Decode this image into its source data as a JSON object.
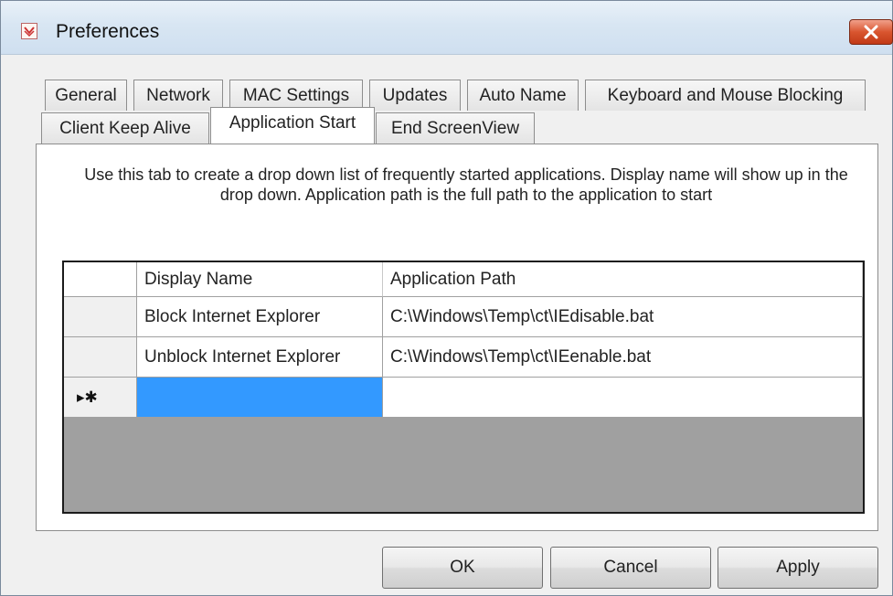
{
  "window": {
    "title": "Preferences"
  },
  "tabs": {
    "row1": [
      "General",
      "Network",
      "MAC Settings",
      "Updates",
      "Auto Name",
      "Keyboard and Mouse Blocking"
    ],
    "row2": [
      "Client Keep Alive",
      "Application Start",
      "End ScreenView"
    ],
    "active": "Application Start"
  },
  "panel": {
    "description": "Use this tab to create a drop down list of frequently started applications. Display name will show up in the drop down. Application path is the full path to the application to start"
  },
  "grid": {
    "columns": [
      "Display Name",
      "Application Path"
    ],
    "rows": [
      {
        "display_name": "Block Internet Explorer",
        "application_path": "C:\\Windows\\Temp\\ct\\IEdisable.bat"
      },
      {
        "display_name": "Unblock Internet Explorer",
        "application_path": "C:\\Windows\\Temp\\ct\\IEenable.bat"
      }
    ],
    "new_row_marker": "▸✱"
  },
  "buttons": {
    "ok": "OK",
    "cancel": "Cancel",
    "apply": "Apply"
  },
  "colors": {
    "selection": "#3399ff",
    "grid_background": "#a0a0a0",
    "close_button": "#c13a17"
  },
  "icons": {
    "app": "preferences-app-icon",
    "close": "close-icon"
  }
}
